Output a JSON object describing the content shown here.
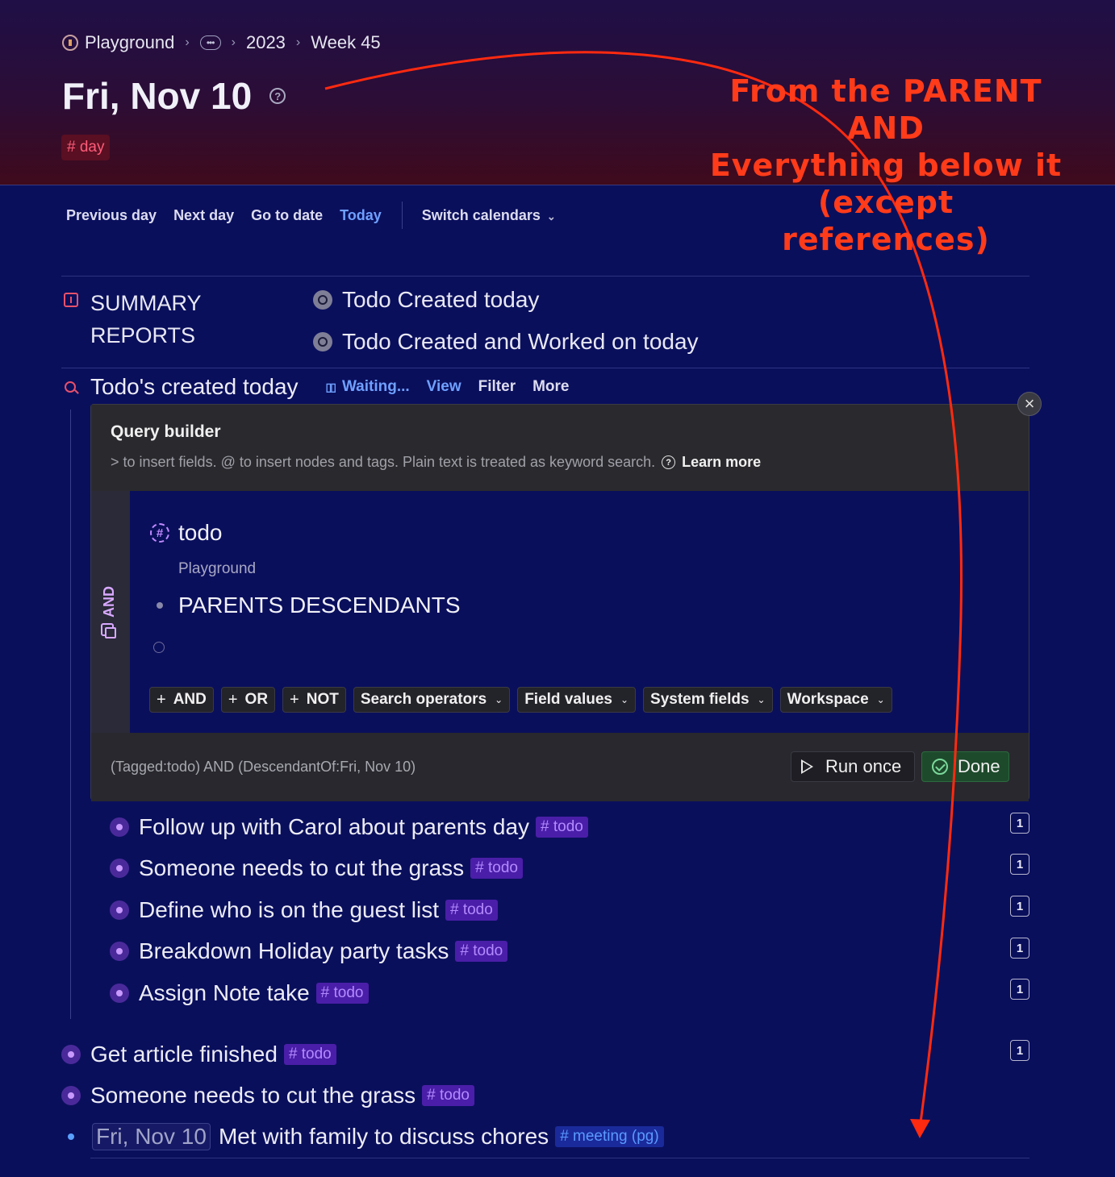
{
  "breadcrumb": {
    "items": [
      "Playground",
      "2023",
      "Week 45"
    ]
  },
  "page": {
    "title": "Fri, Nov 10",
    "tag": "# day"
  },
  "toolbar": {
    "previous": "Previous day",
    "next": "Next day",
    "goto": "Go to date",
    "today": "Today",
    "switch": "Switch calendars"
  },
  "summary": {
    "label": "SUMMARY REPORTS",
    "links": [
      "Todo Created today",
      "Todo Created and Worked on today"
    ]
  },
  "search": {
    "title": "Todo's created today",
    "waiting": "Waiting...",
    "view": "View",
    "filter": "Filter",
    "more": "More"
  },
  "query_builder": {
    "title": "Query builder",
    "hint": "> to insert fields. @ to insert nodes and tags. Plain text is treated as keyword search.",
    "learn_more": "Learn more",
    "rail_label": "AND",
    "tag": "todo",
    "scope": "Playground",
    "operator_item": "PARENTS DESCENDANTS",
    "buttons": {
      "and": "AND",
      "or": "OR",
      "not": "NOT",
      "search_operators": "Search operators",
      "field_values": "Field values",
      "system_fields": "System fields",
      "workspace": "Workspace"
    },
    "expression": "(Tagged:todo) AND (DescendantOf:Fri, Nov 10)",
    "run_once": "Run once",
    "done": "Done"
  },
  "results": [
    {
      "text": "Follow up with Carol about parents day",
      "tag": "# todo",
      "count": "1"
    },
    {
      "text": "Someone needs to cut the grass",
      "tag": "# todo",
      "count": "1"
    },
    {
      "text": "Define who is on the guest list",
      "tag": "# todo",
      "count": "1"
    },
    {
      "text": "Breakdown Holiday party tasks",
      "tag": "# todo",
      "count": "1"
    },
    {
      "text": "Assign Note take",
      "tag": "# todo",
      "count": "1"
    }
  ],
  "outline": [
    {
      "text": "Get article finished",
      "tag": "# todo",
      "count": "1"
    },
    {
      "text": "Someone needs to cut the grass",
      "tag": "# todo"
    }
  ],
  "meeting": {
    "date": "Fri, Nov 10",
    "text": "Met with family to discuss chores",
    "tag": "# meeting (pg)"
  },
  "annotation": {
    "lines": [
      "From the PARENT",
      "AND",
      "Everything below it",
      "(except",
      "references)"
    ],
    "color": "#ff3b1a"
  }
}
